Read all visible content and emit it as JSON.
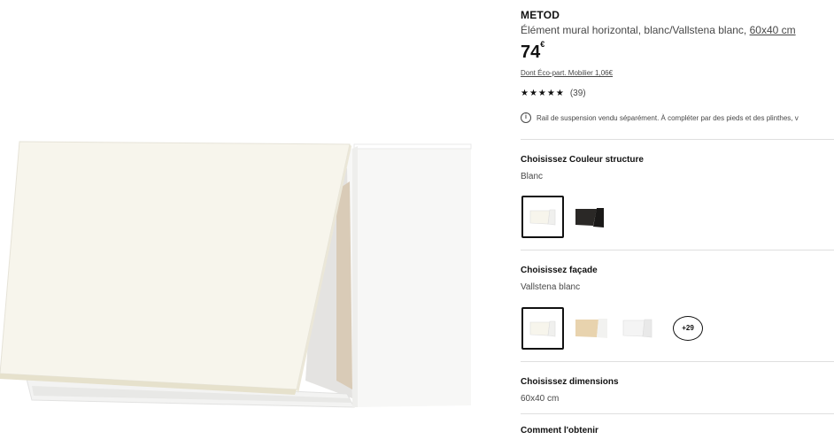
{
  "product": {
    "name": "METOD",
    "description_main": "Élément mural horizontal, blanc/Vallstena blanc, ",
    "description_dimension": "60x40 cm",
    "price_integer": "74",
    "price_currency": "€",
    "eco_text": "Dont Éco-part. Mobilier 1,06€",
    "rating": {
      "stars_glyphs": "★★★★★",
      "value": 4.5,
      "count_text": "(39)"
    },
    "notice_text": "Rail de suspension vendu séparément. À compléter par des pieds et des plinthes, v"
  },
  "sections": {
    "structure": {
      "title": "Choisissez Couleur structure",
      "value": "Blanc"
    },
    "facade": {
      "title": "Choisissez façade",
      "value": "Vallstena blanc",
      "more_label": "+29"
    },
    "dimensions": {
      "title": "Choisissez dimensions",
      "value": "60x40 cm"
    },
    "obtain": {
      "title": "Comment l'obtenir"
    }
  },
  "icons": {
    "info": "info-circle-icon",
    "star": "star-icon"
  },
  "colors": {
    "text": "#111111",
    "muted": "#484848",
    "divider": "#dfdfdf"
  }
}
